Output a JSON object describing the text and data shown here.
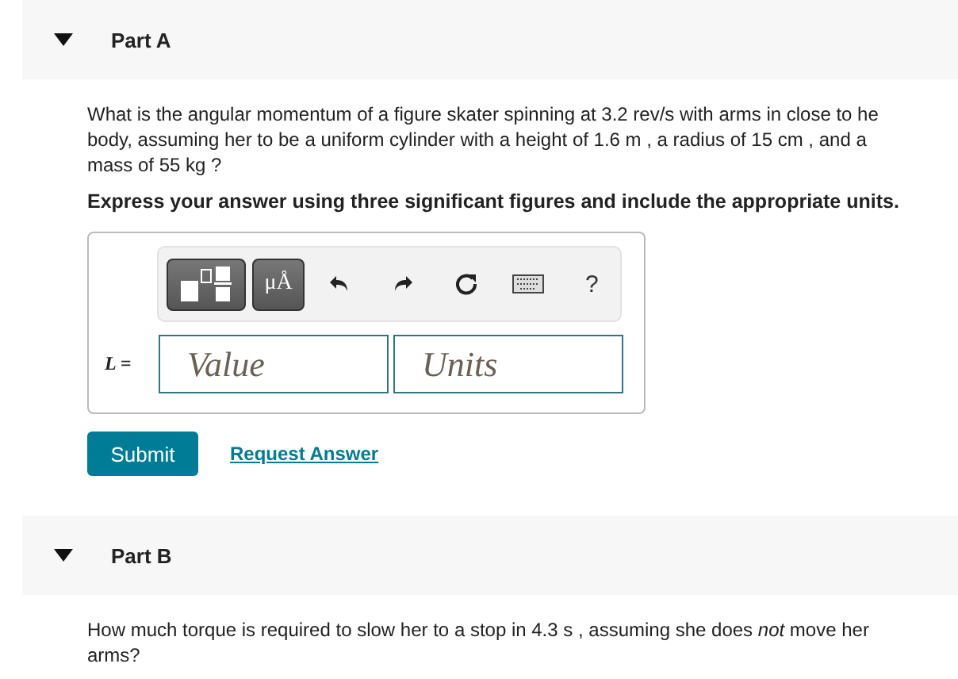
{
  "parts": [
    {
      "title": "Part A",
      "expanded": true,
      "question_lines": [
        "What is the angular momentum of a figure skater spinning at 3.2 rev/s with arms in close to he",
        "body, assuming her to be a uniform cylinder with a height of 1.6 m , a radius of 15 cm , and a",
        "mass of 55 kg ?"
      ],
      "instruction": "Express your answer using three significant figures and include the appropriate units.",
      "answer": {
        "toolbar": [
          "μÅ",
          "?"
        ],
        "label": "L =",
        "value_placeholder": "Value",
        "units_placeholder": "Units"
      },
      "buttons": {
        "submit": "Submit",
        "request": "Request Answer"
      }
    },
    {
      "title": "Part B",
      "expanded": true,
      "question_lines": [
        "How much torque is required to slow her to a stop in 4.3 s , assuming she does *not* move her",
        "arms?"
      ]
    }
  ]
}
